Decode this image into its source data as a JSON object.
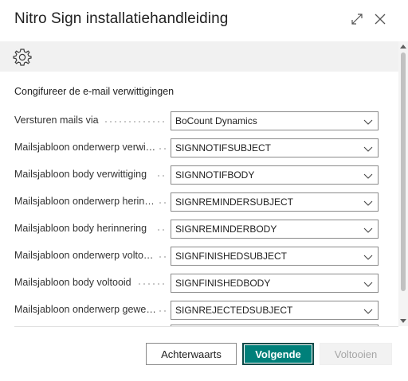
{
  "dialog": {
    "title": "Nitro Sign installatiehandleiding"
  },
  "icons": {
    "expand": "expand-icon",
    "close": "close-icon",
    "settings": "gear-icon",
    "dropdown": "chevron-down-icon"
  },
  "section": {
    "title": "Congifureer de e-mail verwittigingen"
  },
  "fields": [
    {
      "label": "Versturen mails via",
      "value": "BoCount Dynamics"
    },
    {
      "label": "Mailsjabloon onderwerp verwittiging",
      "value": "SIGNNOTIFSUBJECT"
    },
    {
      "label": "Mailsjabloon body verwittiging",
      "value": "SIGNNOTIFBODY"
    },
    {
      "label": "Mailsjabloon onderwerp herinnering",
      "value": "SIGNREMINDERSUBJECT"
    },
    {
      "label": "Mailsjabloon body herinnering",
      "value": "SIGNREMINDERBODY"
    },
    {
      "label": "Mailsjabloon onderwerp voltooid",
      "value": "SIGNFINISHEDSUBJECT"
    },
    {
      "label": "Mailsjabloon body voltooid",
      "value": "SIGNFINISHEDBODY"
    },
    {
      "label": "Mailsjabloon onderwerp geweigerd",
      "value": "SIGNREJECTEDSUBJECT"
    }
  ],
  "buttons": {
    "back": "Achterwaarts",
    "next": "Volgende",
    "finish": "Voltooien"
  },
  "colors": {
    "primary": "#00807a",
    "toolbar_bg": "#f1f1f1",
    "disabled_text": "#a6a6a6"
  }
}
